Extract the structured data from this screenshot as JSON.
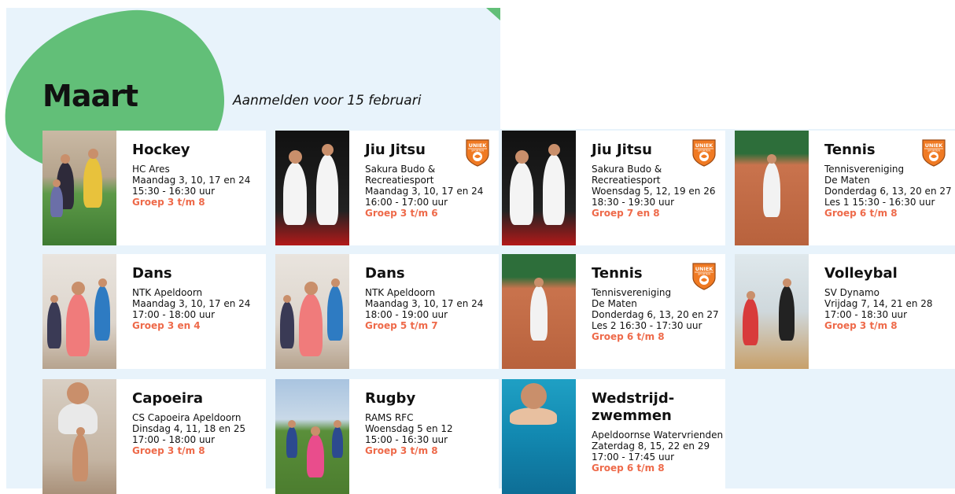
{
  "header": {
    "month": "Maart",
    "register_note": "Aanmelden voor 15 februari"
  },
  "badge_text": {
    "top": "UNIEK",
    "bottom": "SPORTEN"
  },
  "colors": {
    "accent_green": "#62bf78",
    "group_orange": "#ee6a4a",
    "background": "#e8f3fb",
    "badge_orange": "#f07a23"
  },
  "cards": [
    {
      "title": "Hockey",
      "lines": [
        "HC Ares",
        "Maandag 3, 10, 17 en 24",
        "15:30 - 16:30 uur"
      ],
      "group": "Groep 3 t/m 8",
      "badge": false,
      "icon": "hockey-photo"
    },
    {
      "title": "Jiu Jitsu",
      "lines": [
        "Sakura Budo &",
        "Recreatiesport",
        "Maandag 3, 10, 17 en 24",
        "16:00 - 17:00 uur"
      ],
      "group": "Groep 3 t/m 6",
      "badge": true,
      "icon": "jiu-jitsu-photo"
    },
    {
      "title": "Jiu Jitsu",
      "lines": [
        "Sakura Budo &",
        "Recreatiesport",
        "Woensdag 5, 12, 19 en 26",
        "18:30 - 19:30 uur"
      ],
      "group": "Groep 7 en 8",
      "badge": true,
      "icon": "jiu-jitsu-photo"
    },
    {
      "title": "Tennis",
      "lines": [
        "Tennisvereniging",
        "De Maten",
        "Donderdag 6, 13, 20 en 27",
        "Les 1 15:30 - 16:30 uur"
      ],
      "group": "Groep 6 t/m 8",
      "badge": true,
      "icon": "tennis-photo"
    },
    {
      "title": "Dans",
      "lines": [
        "NTK Apeldoorn",
        "Maandag 3, 10, 17 en 24",
        "17:00 - 18:00 uur"
      ],
      "group": "Groep 3 en 4",
      "badge": false,
      "icon": "dance-photo"
    },
    {
      "title": "Dans",
      "lines": [
        "NTK Apeldoorn",
        "Maandag 3, 10, 17 en 24",
        "18:00 - 19:00 uur"
      ],
      "group": "Groep 5 t/m 7",
      "badge": false,
      "icon": "dance-photo"
    },
    {
      "title": "Tennis",
      "lines": [
        "Tennisvereniging",
        "De Maten",
        "Donderdag 6, 13, 20 en 27",
        "Les 2 16:30 - 17:30 uur"
      ],
      "group": "Groep 6 t/m 8",
      "badge": true,
      "icon": "tennis-photo"
    },
    {
      "title": "Volleybal",
      "lines": [
        "SV Dynamo",
        "Vrijdag 7, 14, 21 en 28",
        "17:00 - 18:30 uur"
      ],
      "group": "Groep 3 t/m 8",
      "badge": false,
      "icon": "volleyball-photo"
    },
    {
      "title": "Capoeira",
      "lines": [
        "CS Capoeira Apeldoorn",
        "Dinsdag 4, 11, 18 en 25",
        "17:00 - 18:00 uur"
      ],
      "group": "Groep 3 t/m 8",
      "badge": false,
      "icon": "capoeira-photo"
    },
    {
      "title": "Rugby",
      "lines": [
        "RAMS RFC",
        "Woensdag 5 en 12",
        "15:00 - 16:30 uur"
      ],
      "group": "Groep 3 t/m 8",
      "badge": false,
      "icon": "rugby-photo"
    },
    {
      "title": "Wedstrijd-zwemmen",
      "lines": [
        "Apeldoornse Watervrienden",
        "Zaterdag 8, 15, 22 en 29",
        "17:00 - 17:45 uur"
      ],
      "group": "Groep 6 t/m 8",
      "badge": false,
      "icon": "swimming-photo"
    }
  ]
}
